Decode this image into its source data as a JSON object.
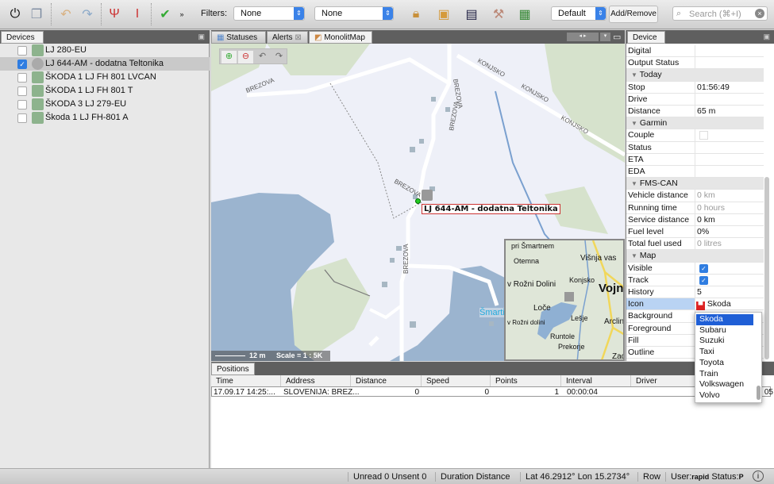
{
  "toolbar": {
    "icons": [
      "power-icon",
      "windows-icon",
      "undo-icon",
      "redo-icon",
      "antenna-icon",
      "marker-icon",
      "check-icon",
      "more-icon",
      "lock-icon",
      "add-layer-icon",
      "screen-icon",
      "tools-icon",
      "add-map-icon"
    ],
    "filters_label": "Filters:",
    "filter1": "None",
    "filter2": "None",
    "layout": "Default",
    "add_remove": "Add/Remove",
    "search_placeholder": "Search (⌘+I)"
  },
  "devices": {
    "tab": "Devices",
    "items": [
      {
        "label": "LJ 280-EU",
        "checked": false
      },
      {
        "label": "LJ 644-AM - dodatna Teltonika",
        "checked": true,
        "selected": true
      },
      {
        "label": "ŠKODA 1 LJ FH 801 LVCAN",
        "checked": false
      },
      {
        "label": "ŠKODA 1 LJ FH 801 T",
        "checked": false
      },
      {
        "label": "ŠKODA 3 LJ 279-EU",
        "checked": false
      },
      {
        "label": "Škoda 1 LJ FH-801 A",
        "checked": false
      }
    ]
  },
  "center_tabs": [
    "Statuses",
    "Alerts",
    "MonolitMap"
  ],
  "map": {
    "streets": [
      "BREZOVA",
      "BREZOVA",
      "BREZOVA",
      "BREZOVA",
      "BREZOVA",
      "KONJSKO",
      "KONJSKO",
      "KONJSKO"
    ],
    "vehicle_label": "LJ 644-AM - dodatna Teltonika",
    "scale_distance": "12 m",
    "scale": "Scale = 1 : 5K",
    "place_smarti": "Šmarti",
    "overview": [
      "pri Šmartnem",
      "Otemna",
      "Višnja vas",
      "v Rožni Dolini",
      "Konjsko",
      "Vojni",
      "Loče",
      "Lešje",
      "v Rožni dolini",
      "Arclin",
      "Runtole",
      "Prekorje",
      "Zad"
    ]
  },
  "props": {
    "tab": "Device",
    "rows": [
      {
        "k": "Digital",
        "v": ""
      },
      {
        "k": "Output Status",
        "v": ""
      },
      {
        "k": "Today",
        "section": true
      },
      {
        "k": "Stop",
        "v": "01:56:49"
      },
      {
        "k": "Drive",
        "v": ""
      },
      {
        "k": "Distance",
        "v": "65 m"
      },
      {
        "k": "Garmin",
        "section": true
      },
      {
        "k": "Couple",
        "v": ""
      },
      {
        "k": "Status",
        "v": ""
      },
      {
        "k": "ETA",
        "v": ""
      },
      {
        "k": "EDA",
        "v": ""
      },
      {
        "k": "FMS-CAN",
        "section": true
      },
      {
        "k": "Vehicle distance",
        "v": "0 km",
        "dim": true
      },
      {
        "k": "Running time",
        "v": "0 hours",
        "dim": true
      },
      {
        "k": "Service distance",
        "v": "0 km"
      },
      {
        "k": "Fuel level",
        "v": "0%"
      },
      {
        "k": "Total fuel used",
        "v": "0 litres",
        "dim": true
      },
      {
        "k": "Map",
        "section": true
      },
      {
        "k": "Visible",
        "check": true
      },
      {
        "k": "Track",
        "check": true
      },
      {
        "k": "History",
        "v": "5"
      },
      {
        "k": "Icon",
        "v": "Skoda",
        "selected": true
      },
      {
        "k": "Background",
        "v": ""
      },
      {
        "k": "Foreground",
        "v": ""
      },
      {
        "k": "Fill",
        "v": ""
      },
      {
        "k": "Outline",
        "v": ""
      }
    ],
    "dropdown": [
      "Skoda",
      "Subaru",
      "Suzuki",
      "Taxi",
      "Toyota",
      "Train",
      "Volkswagen",
      "Volvo"
    ]
  },
  "positions": {
    "tab": "Positions",
    "columns": [
      "Time",
      "Address",
      "Distance",
      "Speed",
      "Points",
      "Interval",
      "Driver"
    ],
    "rows": [
      [
        "17.09.17 14:25:...",
        "SLOVENIJA: BREZ...",
        "0",
        "0",
        "1",
        "00:00:04",
        "",
        "05"
      ]
    ]
  },
  "status": {
    "unread": "Unread 0 Unsent 0",
    "duration": "Duration Distance",
    "latlon": "Lat 46.2912° Lon 15.2734°",
    "row": "Row",
    "user_label": "User:",
    "user": "rapid",
    "status_label": "Status:",
    "status": "P"
  }
}
